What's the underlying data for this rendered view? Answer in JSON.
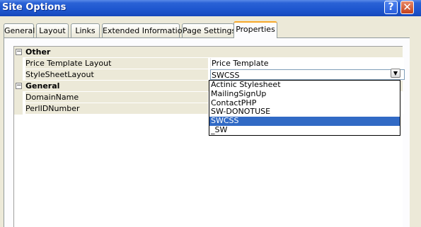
{
  "window": {
    "title": "Site Options",
    "help_glyph": "?",
    "close_glyph": "✕"
  },
  "tabs": [
    {
      "label": "General"
    },
    {
      "label": "Layout"
    },
    {
      "label": "Links"
    },
    {
      "label": "Extended Information"
    },
    {
      "label": "Page Settings"
    },
    {
      "label": "Properties",
      "active": true
    }
  ],
  "grid": {
    "categories": [
      {
        "label": "Other",
        "expander": "⊟",
        "properties": [
          {
            "name": "Price Template Layout",
            "value": "Price Template"
          },
          {
            "name": "StyleSheetLayout",
            "value": "SWCSS"
          }
        ]
      },
      {
        "label": "General",
        "expander": "⊟",
        "properties": [
          {
            "name": "DomainName",
            "value": ""
          },
          {
            "name": "PerlIDNumber",
            "value": ""
          }
        ]
      }
    ]
  },
  "dropdown": {
    "options": [
      "Actinic Stylesheet",
      "MailingSignUp",
      "ContactPHP",
      "SW-DONOTUSE",
      "SWCSS",
      "_SW"
    ],
    "selected": "SWCSS",
    "arrow_glyph": "▼"
  },
  "colors": {
    "titlebar": "#1f57cf",
    "dialog_bg": "#ece9d8",
    "selection": "#316ac5",
    "tab_accent": "#f7a82a"
  }
}
